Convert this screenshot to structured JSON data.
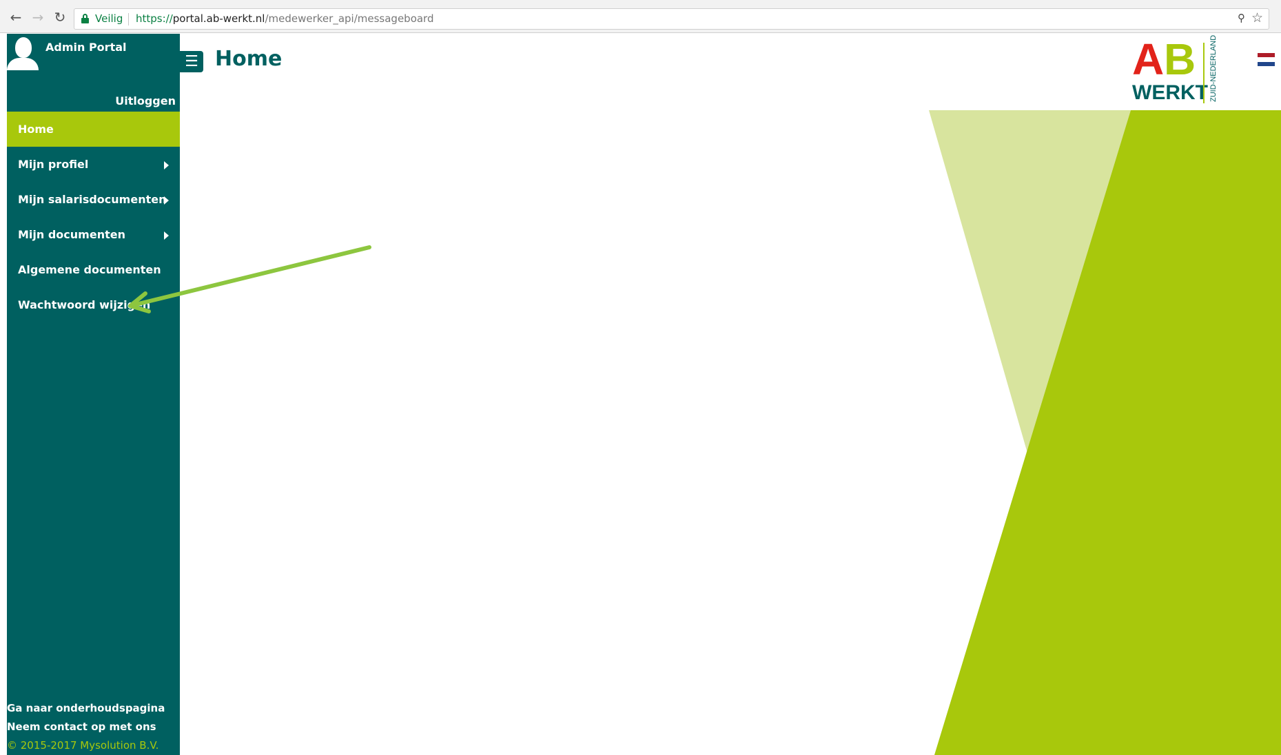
{
  "browser": {
    "secure_label": "Veilig",
    "url_scheme": "https://",
    "url_host": "portal.ab-werkt.nl",
    "url_path": "/medewerker_api/messageboard",
    "back_icon": "arrow-left-icon",
    "forward_icon": "arrow-right-icon",
    "reload_icon": "reload-icon"
  },
  "sidebar": {
    "portal_name": "Admin Portal",
    "logout_label": "Uitloggen",
    "items": [
      {
        "label": "Home",
        "active": true,
        "has_submenu": false
      },
      {
        "label": "Mijn profiel",
        "active": false,
        "has_submenu": true
      },
      {
        "label": "Mijn salarisdocumenten",
        "active": false,
        "has_submenu": true
      },
      {
        "label": "Mijn documenten",
        "active": false,
        "has_submenu": true
      },
      {
        "label": "Algemene documenten",
        "active": false,
        "has_submenu": false
      },
      {
        "label": "Wachtwoord wijzigen",
        "active": false,
        "has_submenu": false
      }
    ],
    "footer": {
      "maintenance_link": "Ga naar onderhoudspagina",
      "contact_link": "Neem contact op met ons",
      "copyright": "© 2015-2017 Mysolution B.V."
    }
  },
  "header": {
    "title": "Home"
  },
  "logo": {
    "letter_a": "A",
    "letter_b": "B",
    "word": "WERKT",
    "region": "ZUID-NEDERLAND"
  },
  "colors": {
    "primary": "#006060",
    "accent": "#a8c80c",
    "accent_light": "#d8e49e",
    "logo_red": "#e2231a"
  }
}
